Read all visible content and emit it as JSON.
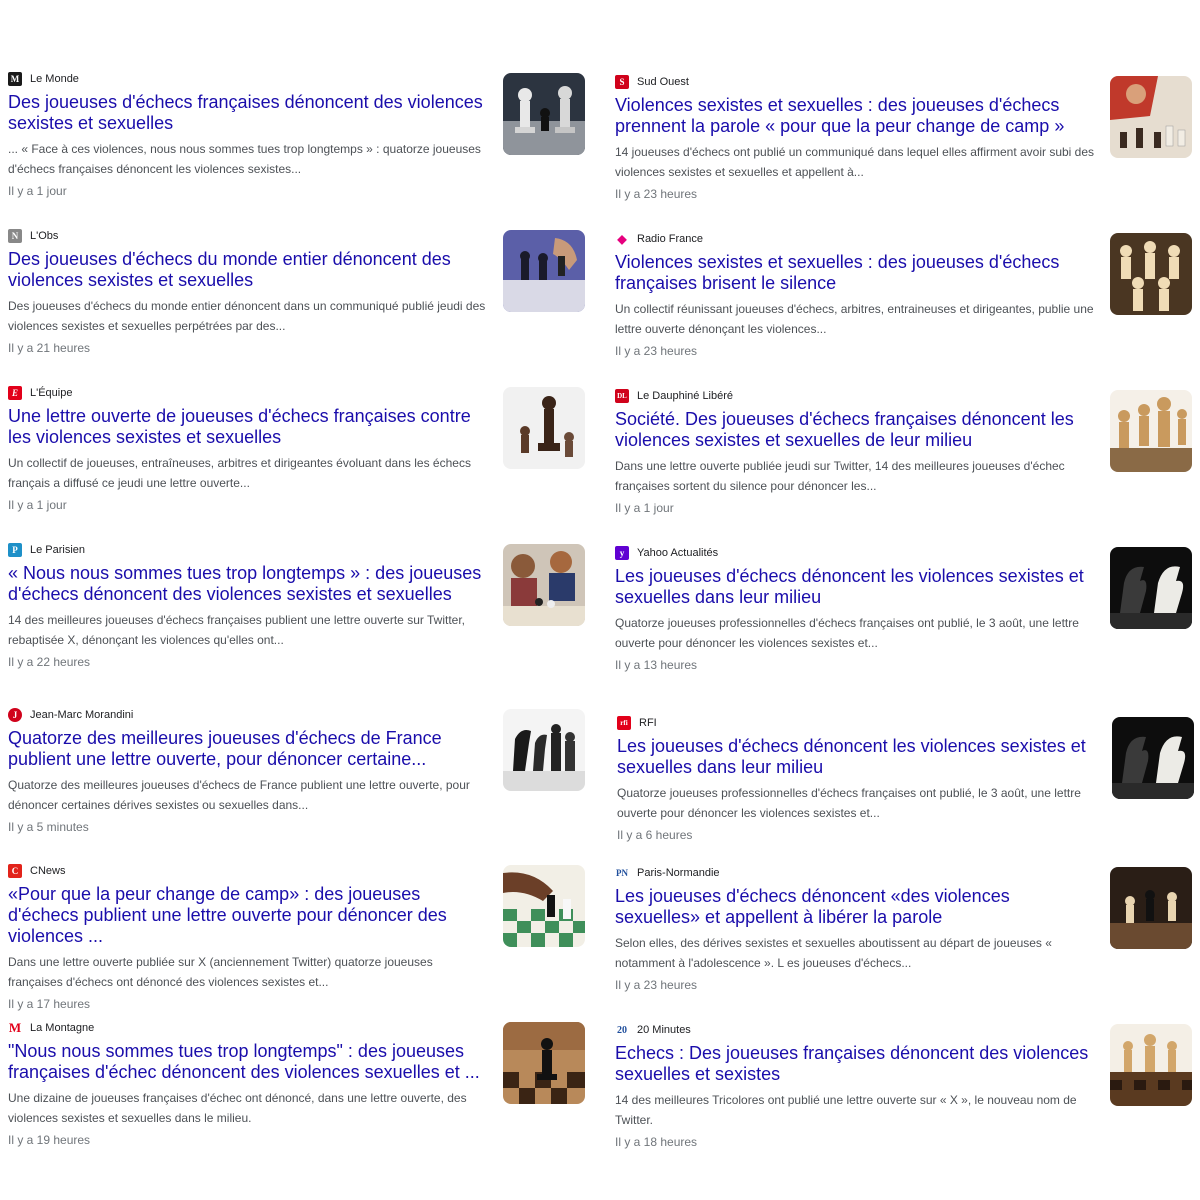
{
  "left": [
    {
      "source": "Le Monde",
      "logo_text": "M",
      "logo_color": "#1a1a1a",
      "title": "Des joueuses d'échecs françaises dénoncent des violences sexistes et sexuelles",
      "snippet": "... « Face à ces violences, nous nous sommes tues trop longtemps » : quatorze joueuses d'échecs françaises dénoncent les violences sexistes...",
      "time": "Il y a 1 jour"
    },
    {
      "source": "L'Obs",
      "logo_text": "N",
      "logo_color": "#888888",
      "title": "Des joueuses d'échecs du monde entier dénoncent des violences sexistes et sexuelles",
      "snippet": "Des joueuses d'échecs du monde entier dénoncent dans un communiqué publié jeudi des violences sexistes et sexuelles perpétrées par des...",
      "time": "Il y a 21 heures"
    },
    {
      "source": "L'Équipe",
      "logo_text": "E",
      "logo_color": "#e2001a",
      "title": "Une lettre ouverte de joueuses d'échecs françaises contre les violences sexistes et sexuelles",
      "snippet": "Un collectif de joueuses, entraîneuses, arbitres et dirigeantes évoluant dans les échecs français a diffusé ce jeudi une lettre ouverte...",
      "time": "Il y a 1 jour"
    },
    {
      "source": "Le Parisien",
      "logo_text": "P",
      "logo_color": "#1e90c8",
      "title": "« Nous nous sommes tues trop longtemps » : des joueuses d'échecs dénoncent des violences sexistes et sexuelles",
      "snippet": "14 des meilleures joueuses d'échecs françaises publient une lettre ouverte sur Twitter, rebaptisée X, dénonçant les violences qu'elles ont...",
      "time": "Il y a 22 heures"
    },
    {
      "source": "Jean-Marc Morandini",
      "logo_text": "J",
      "logo_color": "#d0021b",
      "title": "Quatorze des meilleures joueuses d'échecs de France publient une lettre ouverte, pour dénoncer certaine...",
      "snippet": "Quatorze des meilleures joueuses d'échecs de France publient une lettre ouverte, pour dénoncer certaines dérives sexistes ou sexuelles dans...",
      "time": "Il y a 5 minutes"
    },
    {
      "source": "CNews",
      "logo_text": "C",
      "logo_color": "#e2231a",
      "title": "«Pour que la peur change de camp» : des joueuses d'échecs publient une lettre ouverte pour dénoncer des violences ...",
      "snippet": "Dans une lettre ouverte publiée sur X (anciennement Twitter) quatorze joueuses françaises d'échecs ont dénoncé des violences sexistes et...",
      "time": "Il y a 17 heures"
    },
    {
      "source": "La Montagne",
      "logo_text": "M",
      "logo_color": "#e2001a",
      "title": "\"Nous nous sommes tues trop longtemps\" : des joueuses françaises d'échec dénoncent des violences sexuelles et ...",
      "snippet": "Une dizaine de joueuses françaises d'échec ont dénoncé, dans une lettre ouverte, des violences sexistes et sexuelles dans le milieu.",
      "time": "Il y a 19 heures"
    }
  ],
  "right": [
    {
      "source": "Sud Ouest",
      "logo_text": "S",
      "logo_color": "#d0021b",
      "title": "Violences sexistes et sexuelles : des joueuses d'échecs prennent la parole « pour que la peur change de camp »",
      "snippet": "14 joueuses d'échecs ont publié un communiqué dans lequel elles affirment avoir subi des violences sexistes et sexuelles et appellent à...",
      "time": "Il y a 23 heures"
    },
    {
      "source": "Radio France",
      "logo_text": "◆",
      "logo_color": "#e6007e",
      "title": "Violences sexistes et sexuelles : des joueuses d'échecs françaises brisent le silence",
      "snippet": "Un collectif réunissant joueuses d'échecs, arbitres, entraineuses et dirigeantes, publie une lettre ouverte dénonçant les violences...",
      "time": "Il y a 23 heures"
    },
    {
      "source": "Le Dauphiné Libéré",
      "logo_text": "DL",
      "logo_color": "#d0021b",
      "title": "Société. Des joueuses d'échecs françaises dénoncent les violences sexistes et sexuelles de leur milieu",
      "snippet": "Dans une lettre ouverte publiée jeudi sur Twitter, 14 des meilleures joueuses d'échec françaises sortent du silence pour dénoncer les...",
      "time": "Il y a 1 jour"
    },
    {
      "source": "Yahoo Actualités",
      "logo_text": "y",
      "logo_color": "#6001d2",
      "title": "Les joueuses d'échecs dénoncent les violences sexistes et sexuelles dans leur milieu",
      "snippet": "Quatorze joueuses professionnelles d'échecs françaises ont publié, le 3 août, une lettre ouverte pour dénoncer les violences sexistes et...",
      "time": "Il y a 13 heures"
    },
    {
      "source": "RFI",
      "logo_text": "rfi",
      "logo_color": "#e2001a",
      "title": "Les joueuses d'échecs dénoncent les violences sexistes et sexuelles dans leur milieu",
      "snippet": "Quatorze joueuses professionnelles d'échecs françaises ont publié, le 3 août, une lettre ouverte pour dénoncer les violences sexistes et...",
      "time": "Il y a 6 heures"
    },
    {
      "source": "Paris-Normandie",
      "logo_text": "PN",
      "logo_color": "#1f4e9c",
      "title": "Les joueuses d'échecs dénoncent «des violences sexuelles» et appellent à libérer la parole",
      "snippet": "Selon elles, des dérives sexistes et sexuelles aboutissent au départ de joueuses « notamment à l'adolescence ». L es joueuses d'échecs...",
      "time": "Il y a 23 heures"
    },
    {
      "source": "20 Minutes",
      "logo_text": "20",
      "logo_color": "#1f4e9c",
      "title": "Echecs : Des joueuses françaises dénoncent des violences sexuelles et sexistes",
      "snippet": "14 des meilleures Tricolores ont publié une lettre ouverte sur « X », le nouveau nom de Twitter.",
      "time": "Il y a 18 heures"
    }
  ]
}
